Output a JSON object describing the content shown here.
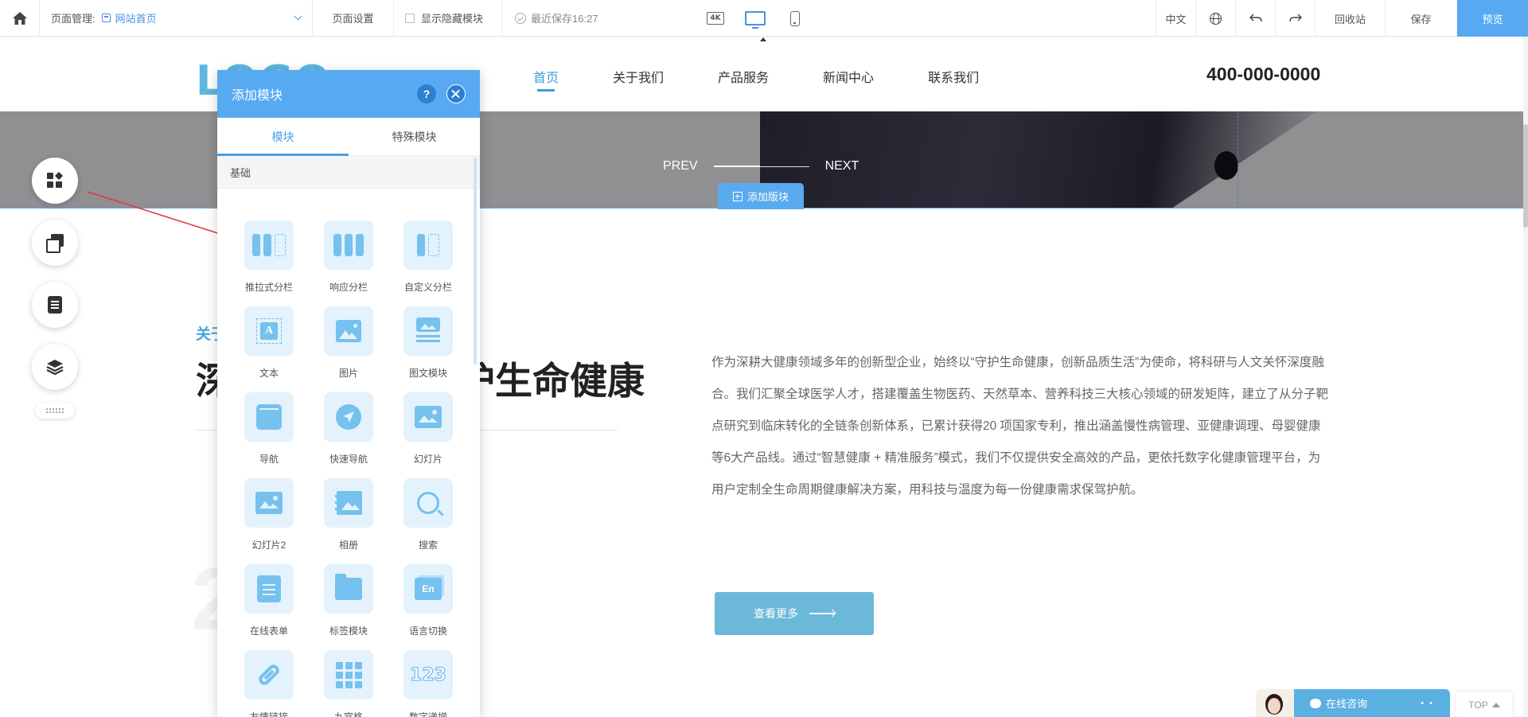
{
  "toolbar": {
    "page_manage_label": "页面管理:",
    "current_page": "网站首页",
    "page_settings": "页面设置",
    "show_hidden": "显示隐藏模块",
    "last_saved": "最近保存16:27",
    "device_4k": "4K",
    "language": "中文",
    "recycle_bin": "回收站",
    "save": "保存",
    "preview": "预览"
  },
  "site": {
    "logo": "LOGO",
    "nav": [
      "首页",
      "关于我们",
      "产品服务",
      "新闻中心",
      "联系我们"
    ],
    "active_nav": "首页",
    "phone": "400-000-0000",
    "slider_prev": "PREV",
    "slider_next": "NEXT",
    "add_block": "添加版块",
    "about_sub": "关于",
    "about_title": "深耕大健康，守护生命健康",
    "about_big_num": "20",
    "about_text": "作为深耕大健康领域多年的创新型企业，始终以“守护生命健康，创新品质生活”为使命，将科研与人文关怀深度融合。我们汇聚全球医学人才，搭建覆盖生物医药、天然草本、营养科技三大核心领域的研发矩阵，建立了从分子靶点研究到临床转化的全链条创新体系，已累计获得20 项国家专利，推出涵盖慢性病管理、亚健康调理、母婴健康等6大产品线。通过“智慧健康 + 精准服务”模式，我们不仅提供安全高效的产品，更依托数字化健康管理平台，为用户定制全生命周期健康解决方案，用科技与温度为每一份健康需求保驾护航。",
    "more_button": "查看更多"
  },
  "panel": {
    "title": "添加模块",
    "help": "?",
    "tabs": [
      "模块",
      "特殊模块"
    ],
    "section": "基础",
    "modules": [
      {
        "label": "推拉式分栏",
        "icon": "pull-columns-icon"
      },
      {
        "label": "响应分栏",
        "icon": "responsive-columns-icon"
      },
      {
        "label": "自定义分栏",
        "icon": "custom-columns-icon"
      },
      {
        "label": "文本",
        "icon": "text-icon"
      },
      {
        "label": "图片",
        "icon": "image-icon"
      },
      {
        "label": "图文模块",
        "icon": "image-text-icon"
      },
      {
        "label": "导航",
        "icon": "navigation-icon"
      },
      {
        "label": "快速导航",
        "icon": "quick-nav-icon"
      },
      {
        "label": "幻灯片",
        "icon": "slideshow-icon"
      },
      {
        "label": "幻灯片2",
        "icon": "slideshow2-icon"
      },
      {
        "label": "相册",
        "icon": "album-icon"
      },
      {
        "label": "搜索",
        "icon": "search-icon"
      },
      {
        "label": "在线表单",
        "icon": "online-form-icon"
      },
      {
        "label": "标签模块",
        "icon": "tab-module-icon"
      },
      {
        "label": "语言切换",
        "icon": "language-switch-icon"
      },
      {
        "label": "友情链接",
        "icon": "friend-link-icon"
      },
      {
        "label": "九宫格",
        "icon": "nine-grid-icon"
      },
      {
        "label": "数字递增",
        "icon": "number-increment-icon"
      }
    ]
  },
  "chat": {
    "label": "在线咨询",
    "dots": "• •",
    "top": "TOP"
  },
  "colors": {
    "accent": "#57a9f2",
    "brand": "#5cb8de",
    "module_icon": "#76c1ee",
    "module_bg": "#e3f2fc"
  }
}
